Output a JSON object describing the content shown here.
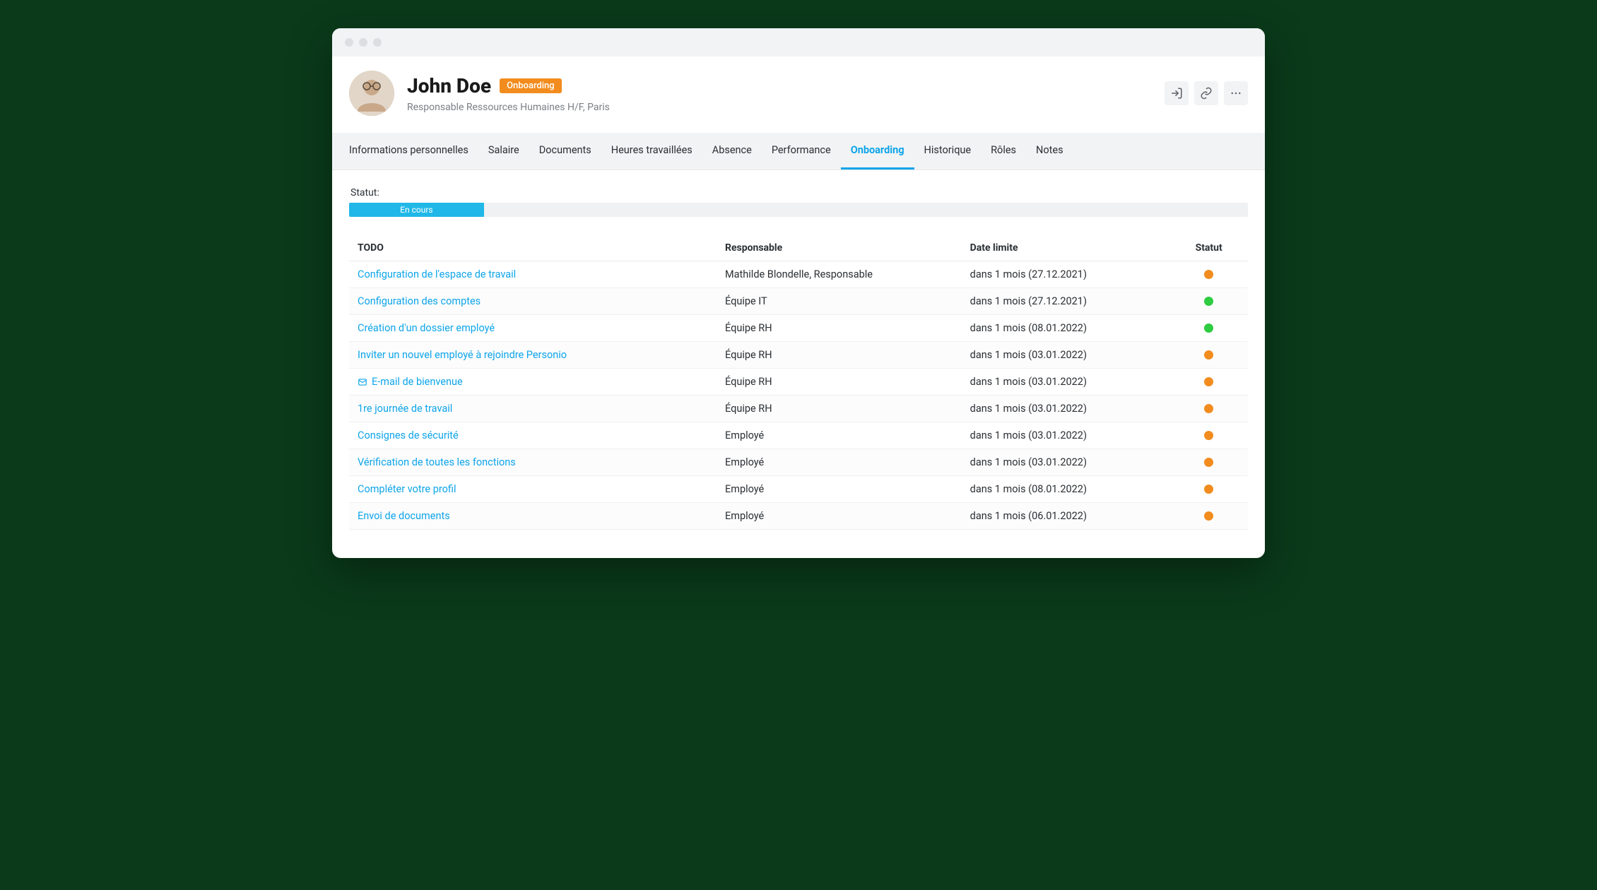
{
  "header": {
    "name": "John Doe",
    "badge": "Onboarding",
    "subtitle": "Responsable Ressources Humaines H/F, Paris"
  },
  "tabs": [
    {
      "label": "Informations personnelles",
      "active": false
    },
    {
      "label": "Salaire",
      "active": false
    },
    {
      "label": "Documents",
      "active": false
    },
    {
      "label": "Heures travaillées",
      "active": false
    },
    {
      "label": "Absence",
      "active": false
    },
    {
      "label": "Performance",
      "active": false
    },
    {
      "label": "Onboarding",
      "active": true
    },
    {
      "label": "Historique",
      "active": false
    },
    {
      "label": "Rôles",
      "active": false
    },
    {
      "label": "Notes",
      "active": false
    }
  ],
  "status": {
    "label": "Statut:",
    "text": "En cours",
    "percent": 15
  },
  "columns": {
    "todo": "TODO",
    "responsible": "Responsable",
    "deadline": "Date limite",
    "status": "Statut"
  },
  "rows": [
    {
      "todo": "Configuration de l'espace de travail",
      "icon": null,
      "responsible": "Mathilde Blondelle, Responsable",
      "deadline": "dans 1 mois (27.12.2021)",
      "status": "orange"
    },
    {
      "todo": "Configuration des comptes",
      "icon": null,
      "responsible": "Équipe IT",
      "deadline": "dans 1 mois (27.12.2021)",
      "status": "green"
    },
    {
      "todo": "Création d'un dossier employé",
      "icon": null,
      "responsible": "Équipe RH",
      "deadline": "dans 1 mois (08.01.2022)",
      "status": "green"
    },
    {
      "todo": "Inviter un nouvel employé à rejoindre Personio",
      "icon": null,
      "responsible": "Équipe RH",
      "deadline": "dans 1 mois (03.01.2022)",
      "status": "orange"
    },
    {
      "todo": "E-mail de bienvenue",
      "icon": "mail",
      "responsible": "Équipe RH",
      "deadline": "dans 1 mois (03.01.2022)",
      "status": "orange"
    },
    {
      "todo": "1re journée de travail",
      "icon": null,
      "responsible": "Équipe RH",
      "deadline": "dans 1 mois (03.01.2022)",
      "status": "orange"
    },
    {
      "todo": "Consignes de sécurité",
      "icon": null,
      "responsible": "Employé",
      "deadline": "dans 1 mois (03.01.2022)",
      "status": "orange"
    },
    {
      "todo": "Vérification de toutes les fonctions",
      "icon": null,
      "responsible": "Employé",
      "deadline": "dans 1 mois (03.01.2022)",
      "status": "orange"
    },
    {
      "todo": "Compléter votre profil",
      "icon": null,
      "responsible": "Employé",
      "deadline": "dans 1 mois (08.01.2022)",
      "status": "orange"
    },
    {
      "todo": "Envoi de documents",
      "icon": null,
      "responsible": "Employé",
      "deadline": "dans 1 mois (06.01.2022)",
      "status": "orange"
    }
  ]
}
